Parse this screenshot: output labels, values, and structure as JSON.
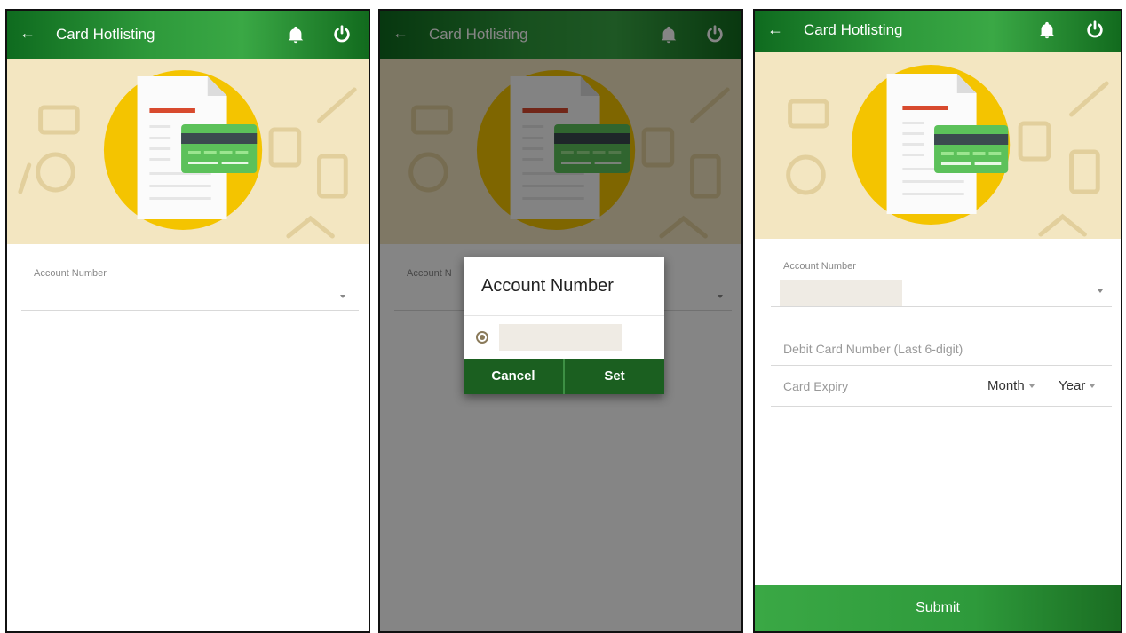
{
  "header": {
    "back_glyph": "←",
    "title": "Card Hotlisting",
    "icons": [
      "bell-icon",
      "power-icon"
    ]
  },
  "screen1": {
    "account_label": "Account Number"
  },
  "screen2": {
    "account_label": "Account N",
    "dialog": {
      "title": "Account Number",
      "cancel_label": "Cancel",
      "set_label": "Set"
    }
  },
  "screen3": {
    "account_label": "Account Number",
    "debit_card_placeholder": "Debit Card Number (Last 6-digit)",
    "card_expiry_label": "Card Expiry",
    "month_label": "Month",
    "year_label": "Year",
    "submit_label": "Submit"
  },
  "colors": {
    "appbar_green": "#2e9a3b",
    "dialog_button_green": "#1b5f20",
    "banner_bg": "#f3e6c1",
    "yellow_circle": "#f4c400",
    "card_green": "#5cc15a"
  }
}
